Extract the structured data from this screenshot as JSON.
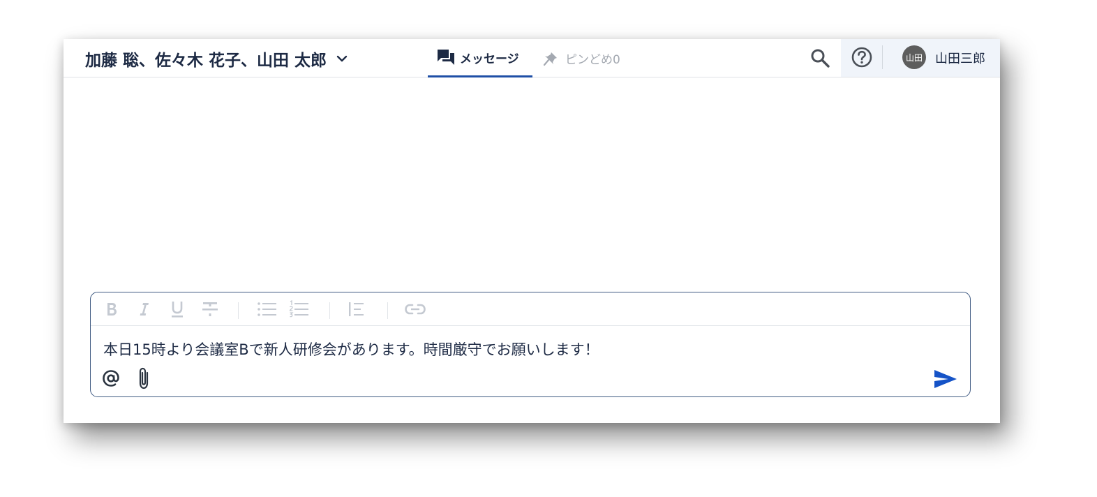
{
  "header": {
    "title": "加藤 聡、佐々木 花子、山田 太郎",
    "tabs": {
      "messages": "メッセージ",
      "pins": "ピンどめ0"
    },
    "user": {
      "avatar_text": "山田",
      "name": "山田三郎",
      "avatar_color": "#5d5d5d"
    }
  },
  "composer": {
    "message": "本日15時より会議室Bで新人研修会があります。時間厳守でお願いします！",
    "toolbar_icons": [
      "bold-icon",
      "italic-icon",
      "underline-icon",
      "strikethrough-icon",
      "bulleted-list-icon",
      "numbered-list-icon",
      "blockquote-icon",
      "link-icon"
    ],
    "bottom_icons": [
      "mention-icon",
      "attachment-icon",
      "send-icon"
    ]
  },
  "colors": {
    "accent": "#1f4fa6",
    "send": "#1553c7",
    "title_text": "#1d2a44",
    "disabled": "#c4c9d1"
  }
}
